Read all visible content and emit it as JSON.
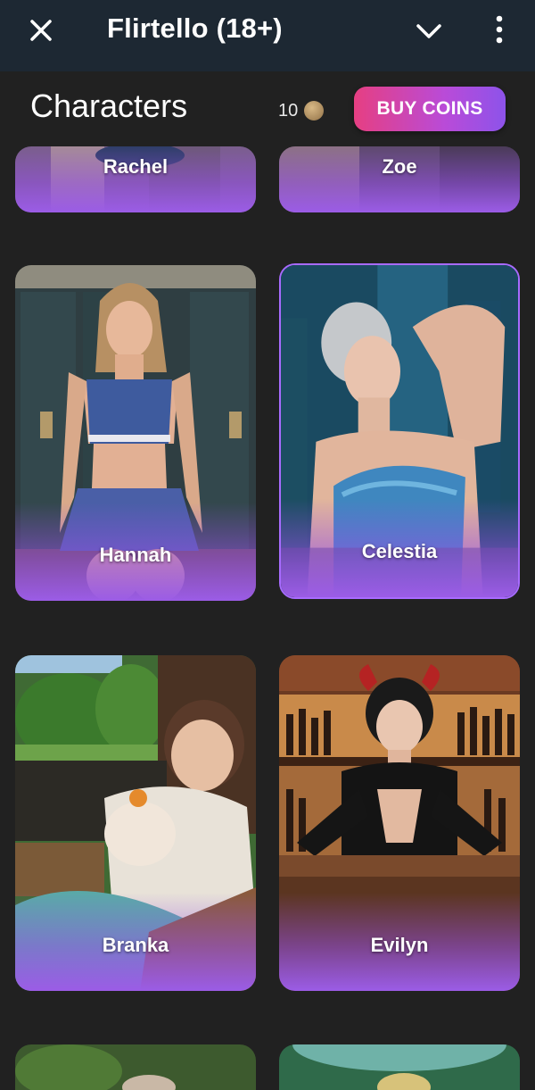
{
  "topbar": {
    "title": "Flirtello (18+)"
  },
  "header": {
    "heading": "Characters",
    "coins": "10",
    "buy_label": "BUY COINS"
  },
  "characters": [
    {
      "name": "Rachel"
    },
    {
      "name": "Zoe"
    },
    {
      "name": "Hannah"
    },
    {
      "name": "Celestia"
    },
    {
      "name": "Branka"
    },
    {
      "name": "Evilyn"
    }
  ],
  "colors": {
    "topbar": "#1d2833",
    "background": "#212121",
    "accent_pink": "#e63f82",
    "accent_purple": "#8d53ea",
    "card_fade": "#9b5ce6"
  }
}
